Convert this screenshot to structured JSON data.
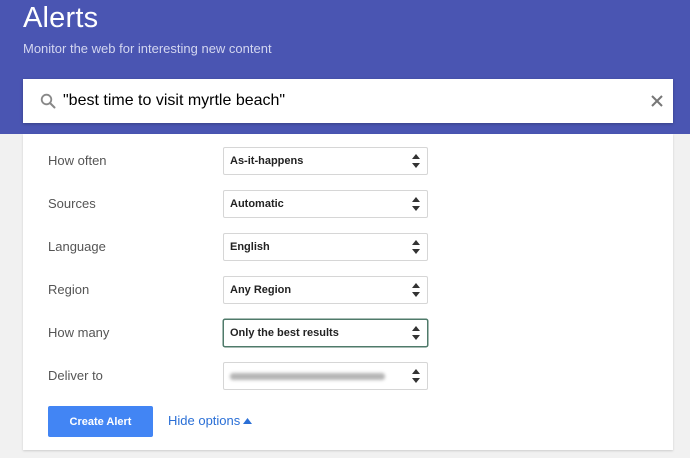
{
  "header": {
    "title": "Alerts",
    "subtitle": "Monitor the web for interesting new content",
    "color": "#4a55b2"
  },
  "search": {
    "value": "\"best time to visit myrtle beach\"",
    "search_icon": "search-icon",
    "clear_icon": "close-icon"
  },
  "options": [
    {
      "label": "How often",
      "value": "As-it-happens"
    },
    {
      "label": "Sources",
      "value": "Automatic"
    },
    {
      "label": "Language",
      "value": "English"
    },
    {
      "label": "Region",
      "value": "Any Region"
    },
    {
      "label": "How many",
      "value": "Only the best results"
    },
    {
      "label": "Deliver to",
      "value": "",
      "blurred": true
    }
  ],
  "actions": {
    "create_label": "Create Alert",
    "hide_options_label": "Hide options",
    "button_color": "#4285f4"
  }
}
